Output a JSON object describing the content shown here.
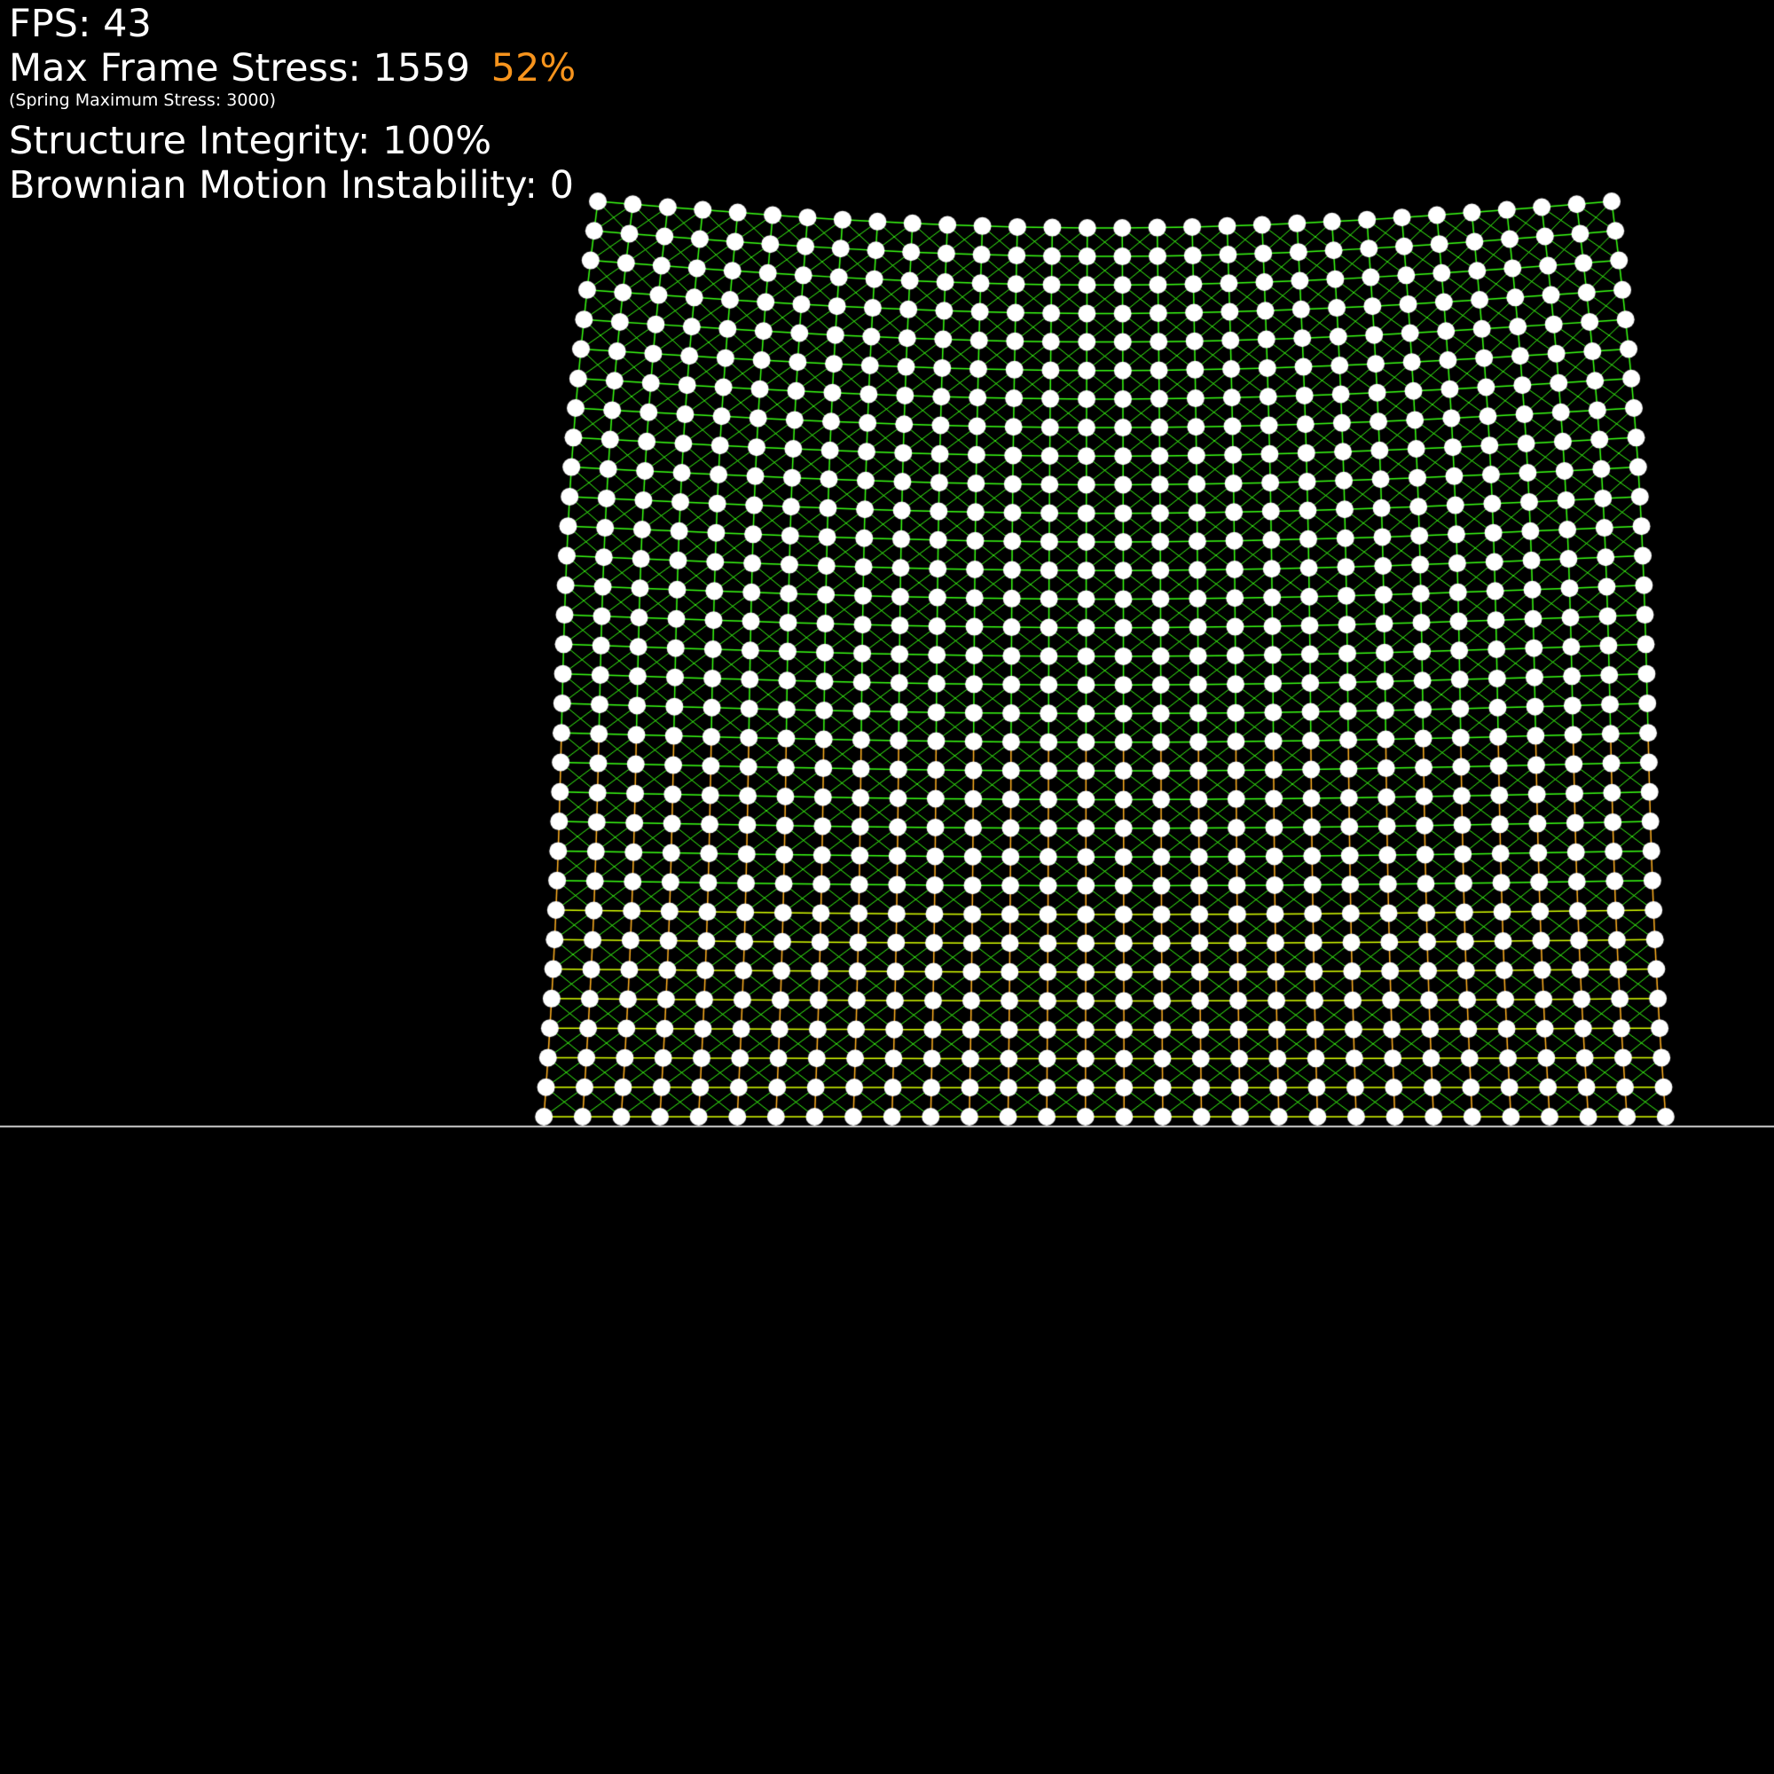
{
  "hud": {
    "fps_label": "FPS:",
    "fps_value": "43",
    "max_stress_label": "Max Frame Stress:",
    "max_stress_value": "1559",
    "max_stress_percent": "52%",
    "spring_max_note": "(Spring Maximum Stress: 3000)",
    "integrity_label": "Structure Integrity:",
    "integrity_value": "100%",
    "brownian_label": "Brownian Motion Instability:",
    "brownian_value": "0"
  },
  "colors": {
    "background": "#000000",
    "text": "#ffffff",
    "stress_highlight": "#f7941d",
    "node": "#ffffff",
    "spring_low_stress": "#39ff14",
    "spring_mid_stress": "#d9ff00",
    "spring_high_stress": "#ffb020",
    "ground_line": "#cfcfcf"
  },
  "simulation": {
    "grid_columns": 30,
    "grid_rows": 32,
    "max_frame_stress_ratio": 0.52
  }
}
